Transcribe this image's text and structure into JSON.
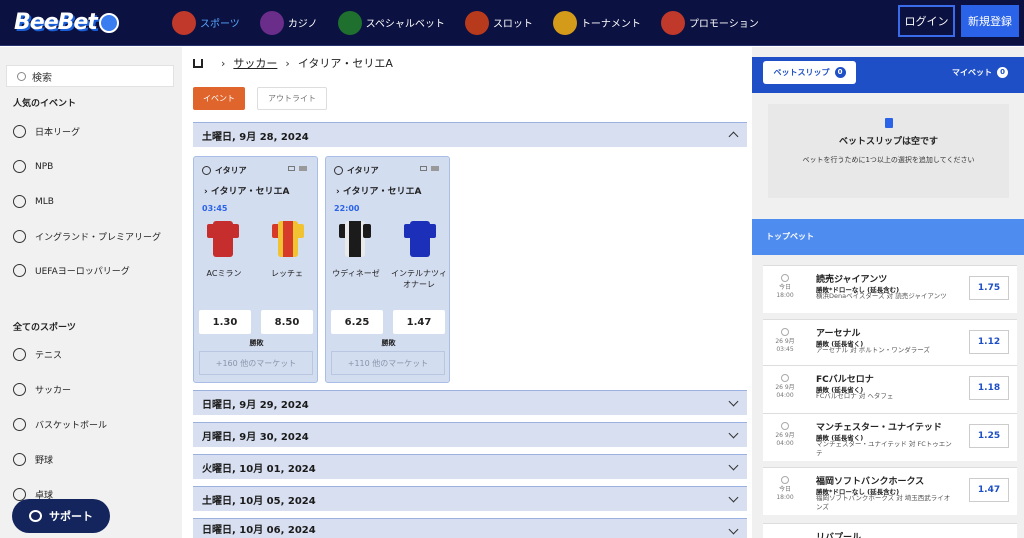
{
  "brand": {
    "logo": "BeeBet"
  },
  "nav": [
    {
      "label": "スポーツ",
      "icon": "sports-icon",
      "color": "#c0392b",
      "active": true
    },
    {
      "label": "カジノ",
      "icon": "casino-icon",
      "color": "#6b2d8a"
    },
    {
      "label": "スペシャルベット",
      "icon": "special-bet-icon",
      "color": "#1f6f2e"
    },
    {
      "label": "スロット",
      "icon": "slots-icon",
      "color": "#b83a1c"
    },
    {
      "label": "トーナメント",
      "icon": "tournament-icon",
      "color": "#d49a1a"
    },
    {
      "label": "プロモーション",
      "icon": "promotion-icon",
      "color": "#c0392b"
    }
  ],
  "auth": {
    "login": "ログイン",
    "register": "新規登録"
  },
  "sidebar": {
    "search_placeholder": "検索",
    "popular_heading": "人気のイベント",
    "popular": [
      "日本リーグ",
      "NPB",
      "MLB",
      "イングランド・プレミアリーグ",
      "UEFAヨーロッパリーグ"
    ],
    "all_heading": "全てのスポーツ",
    "sports": [
      "テニス",
      "サッカー",
      "バスケットボール",
      "野球",
      "卓球"
    ],
    "support": "サポート"
  },
  "breadcrumb": {
    "level1": "サッカー",
    "level2": "イタリア・セリエA"
  },
  "tabs": {
    "events": "イベント",
    "outrights": "アウトライト"
  },
  "days": [
    "土曜日, 9月 28, 2024",
    "日曜日, 9月 29, 2024",
    "月曜日, 9月 30, 2024",
    "火曜日, 10月 01, 2024",
    "土曜日, 10月 05, 2024",
    "日曜日, 10月 06, 2024"
  ],
  "matches": [
    {
      "country": "イタリア",
      "competition": "イタリア・セリエA",
      "time": "03:45",
      "home": "ACミラン",
      "away": "レッチェ",
      "odd_home": "1.30",
      "odd_away": "8.50",
      "market": "勝敗",
      "more": "+160 他のマーケット",
      "home_colors": [
        "#c62e2e",
        "#c62e2e"
      ],
      "away_colors": [
        "#d63b2a",
        "#f1c232"
      ]
    },
    {
      "country": "イタリア",
      "competition": "イタリア・セリエA",
      "time": "22:00",
      "home": "ウディネーゼ",
      "away": "インテルナツィオナーレ",
      "odd_home": "6.25",
      "odd_away": "1.47",
      "market": "勝敗",
      "more": "+110 他のマーケット",
      "home_colors": [
        "#1b1b1b",
        "#e9e9e9"
      ],
      "away_colors": [
        "#1b2fb8",
        "#111"
      ]
    }
  ],
  "betslip": {
    "label": "ベットスリップ",
    "count": "0",
    "mybets": "マイベット",
    "mybets_count": "0",
    "empty_title": "ベットスリップは空です",
    "empty_desc": "ベットを行うために1つ以上の選択を追加してください"
  },
  "topbets": {
    "heading": "トップベット",
    "items": [
      {
        "date": "今日",
        "time": "18:00",
        "team": "読売ジャイアンツ",
        "market": "勝敗*ドローなし (延長含む)",
        "match": "横浜Denaベイスターズ 対 読売ジャイアンツ",
        "odd": "1.75"
      },
      {
        "date": "26 9月",
        "time": "03:45",
        "team": "アーセナル",
        "market": "勝敗 (延長省く)",
        "match": "アーセナル 対 ボルトン・ワンダラーズ",
        "odd": "1.12"
      },
      {
        "date": "26 9月",
        "time": "04:00",
        "team": "FCバルセロナ",
        "market": "勝敗 (延長省く)",
        "match": "FCバルセロナ 対 ヘタフェ",
        "odd": "1.18"
      },
      {
        "date": "26 9月",
        "time": "04:00",
        "team": "マンチェスター・ユナイテッド",
        "market": "勝敗 (延長省く)",
        "match": "マンチェスター・ユナイテッド 対 FCトゥエンテ",
        "odd": "1.25"
      },
      {
        "date": "今日",
        "time": "18:00",
        "team": "福岡ソフトバンクホークス",
        "market": "勝敗*ドローなし (延長含む)",
        "match": "福岡ソフトバンクホークス 対 埼玉西武ライオンズ",
        "odd": "1.47"
      },
      {
        "date": "",
        "time": "",
        "team": "リバプール",
        "market": "",
        "match": "",
        "odd": ""
      }
    ]
  }
}
